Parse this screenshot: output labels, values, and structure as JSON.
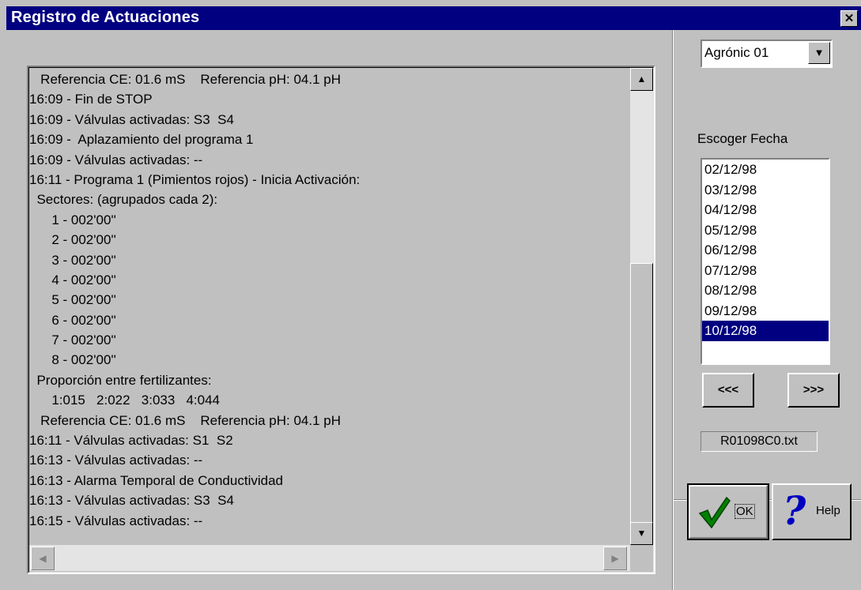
{
  "window": {
    "title": "Registro de Actuaciones",
    "close_glyph": "✕"
  },
  "log": {
    "lines": [
      "   Referencia CE: 01.6 mS    Referencia pH: 04.1 pH",
      "16:09 - Fin de STOP",
      "16:09 - Válvulas activadas: S3  S4",
      "16:09 -  Aplazamiento del programa 1",
      "16:09 - Válvulas activadas: --",
      "16:11 - Programa 1 (Pimientos rojos) - Inicia Activación:",
      "  Sectores: (agrupados cada 2):",
      "      1 - 002'00''",
      "      2 - 002'00''",
      "      3 - 002'00''",
      "      4 - 002'00''",
      "      5 - 002'00''",
      "      6 - 002'00''",
      "      7 - 002'00''",
      "      8 - 002'00''",
      "  Proporción entre fertilizantes:",
      "      1:015   2:022   3:033   4:044",
      "   Referencia CE: 01.6 mS    Referencia pH: 04.1 pH",
      "16:11 - Válvulas activadas: S1  S2",
      "16:13 - Válvulas activadas: --",
      "16:13 - Alarma Temporal de Conductividad",
      "16:13 - Válvulas activadas: S3  S4",
      "16:15 - Válvulas activadas: --"
    ]
  },
  "scroll": {
    "up": "▲",
    "down": "▼",
    "left": "◀",
    "right": "▶"
  },
  "device_select": {
    "value": "Agrónic 01",
    "arrow": "▼"
  },
  "date_picker": {
    "label": "Escoger Fecha",
    "dates": [
      "02/12/98",
      "03/12/98",
      "04/12/98",
      "05/12/98",
      "06/12/98",
      "07/12/98",
      "08/12/98",
      "09/12/98",
      "10/12/98"
    ],
    "selected": "10/12/98"
  },
  "nav": {
    "prev": "<<<",
    "next": ">>>"
  },
  "file": {
    "name": "R01098C0.txt"
  },
  "buttons": {
    "ok": "OK",
    "help": "Help"
  }
}
